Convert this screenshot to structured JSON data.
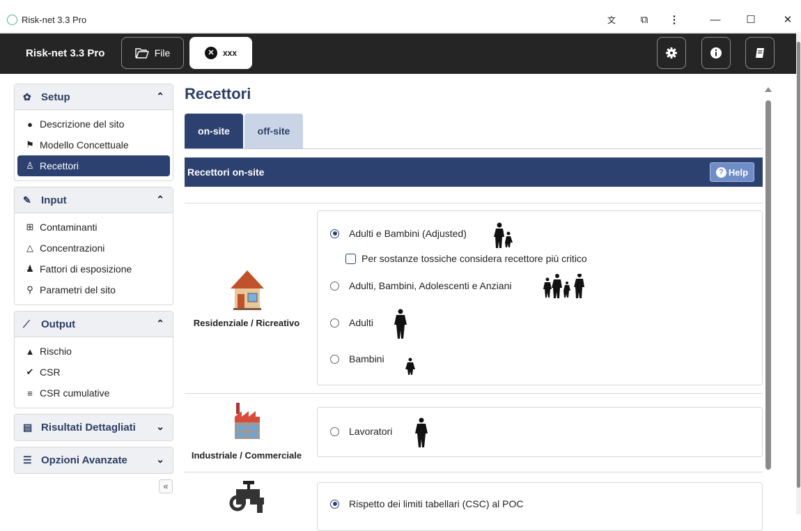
{
  "window": {
    "title": "Risk-net 3.3 Pro",
    "minimize": "—",
    "maximize": "☐",
    "close": "✕"
  },
  "toolbar": {
    "brand": "Risk-net 3.3 Pro",
    "file_label": "File",
    "project_label": "xxx",
    "settings_icon": "gear-icon",
    "info_icon": "info-icon",
    "manual_icon": "book-icon"
  },
  "sidebar": {
    "sections": [
      {
        "label": "Setup",
        "icon": "gear-icon",
        "expanded": true,
        "items": [
          {
            "label": "Descrizione del sito",
            "icon": "info-circle-icon"
          },
          {
            "label": "Modello Concettuale",
            "icon": "sitemap-icon"
          },
          {
            "label": "Recettori",
            "icon": "person-icon",
            "active": true
          }
        ]
      },
      {
        "label": "Input",
        "icon": "edit-icon",
        "expanded": true,
        "items": [
          {
            "label": "Contaminanti",
            "icon": "plus-square-icon"
          },
          {
            "label": "Concentrazioni",
            "icon": "flask-icon"
          },
          {
            "label": "Fattori di esposizione",
            "icon": "user-icon"
          },
          {
            "label": "Parametri del sito",
            "icon": "map-marker-icon"
          }
        ]
      },
      {
        "label": "Output",
        "icon": "line-chart-icon",
        "expanded": true,
        "items": [
          {
            "label": "Rischio",
            "icon": "warning-icon"
          },
          {
            "label": "CSR",
            "icon": "check-circle-icon"
          },
          {
            "label": "CSR cumulative",
            "icon": "list-icon"
          }
        ]
      },
      {
        "label": "Risultati Dettagliati",
        "icon": "table-icon",
        "expanded": false,
        "items": []
      },
      {
        "label": "Opzioni Avanzate",
        "icon": "sliders-icon",
        "expanded": false,
        "items": []
      }
    ],
    "collapse": "«"
  },
  "main": {
    "title": "Recettori",
    "tabs": [
      {
        "label": "on-site",
        "active": true
      },
      {
        "label": "off-site",
        "active": false
      }
    ],
    "panel_title": "Recettori on-site",
    "help_label": "Help",
    "categories": [
      {
        "label": "Residenziale / Ricreativo",
        "icon": "house-icon",
        "options": [
          {
            "label": "Adulti e Bambini (Adjusted)",
            "selected": true
          },
          {
            "label": "Per sostanze tossiche considera recettore più critico",
            "checkbox": true,
            "checked": false
          },
          {
            "label": "Adulti, Bambini, Adolescenti e Anziani",
            "selected": false
          },
          {
            "label": "Adulti",
            "selected": false
          },
          {
            "label": "Bambini",
            "selected": false
          }
        ]
      },
      {
        "label": "Industriale / Commerciale",
        "icon": "factory-icon",
        "options": [
          {
            "label": "Lavoratori",
            "selected": false
          }
        ]
      },
      {
        "label": "",
        "icon": "tap-icon",
        "options": [
          {
            "label": "Rispetto dei limiti tabellari (CSC) al POC",
            "selected": true
          }
        ]
      }
    ]
  }
}
